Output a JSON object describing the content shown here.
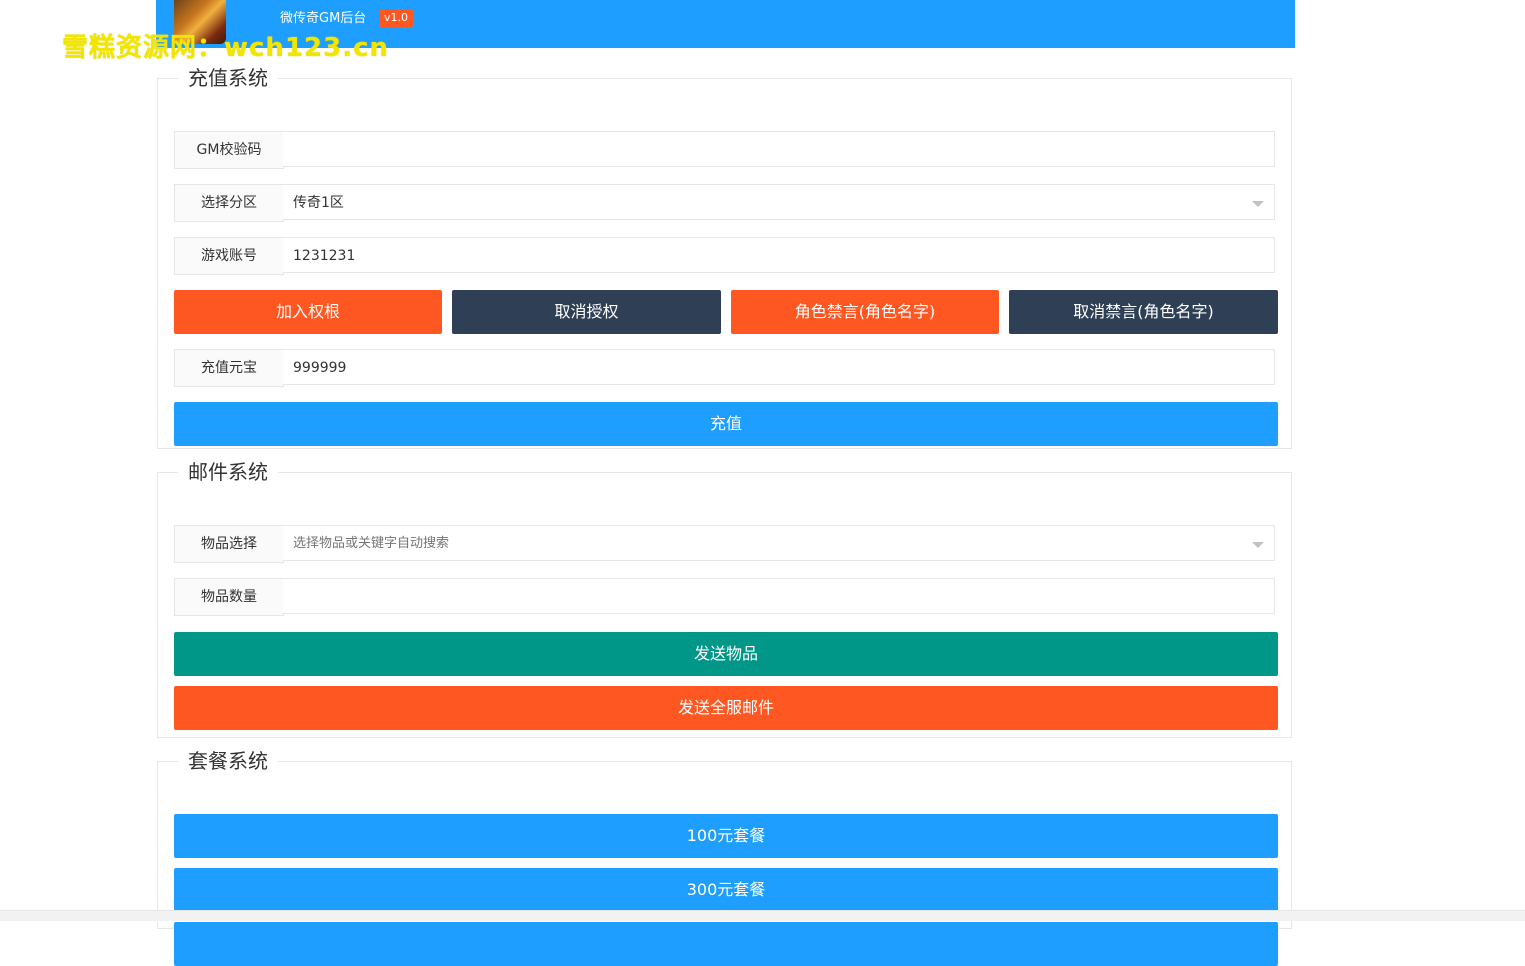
{
  "header": {
    "app_title": "微传奇GM后台",
    "version": "v1.0",
    "watermark": "雪糕资源网：wch123.cn"
  },
  "recharge": {
    "legend": "充值系统",
    "gm_code": {
      "label": "GM校验码",
      "value": ""
    },
    "zone": {
      "label": "选择分区",
      "value": "传奇1区"
    },
    "account": {
      "label": "游戏账号",
      "value": "1231231"
    },
    "buttons": {
      "grant": "加入权根",
      "revoke": "取消授权",
      "mute": "角色禁言(角色名字)",
      "unmute": "取消禁言(角色名字)"
    },
    "ingot": {
      "label": "充值元宝",
      "value": "999999"
    },
    "submit": "充值"
  },
  "mail": {
    "legend": "邮件系统",
    "item_select": {
      "label": "物品选择",
      "placeholder": "选择物品或关键字自动搜索"
    },
    "item_count": {
      "label": "物品数量",
      "value": ""
    },
    "send_item": "发送物品",
    "send_all": "发送全服邮件"
  },
  "package": {
    "legend": "套餐系统",
    "buttons": [
      "100元套餐",
      "300元套餐"
    ]
  },
  "colors": {
    "primary_blue": "#1e9fff",
    "orange": "#ff5722",
    "dark": "#2f4056",
    "green": "#009688",
    "watermark_yellow": "#f2e600"
  }
}
